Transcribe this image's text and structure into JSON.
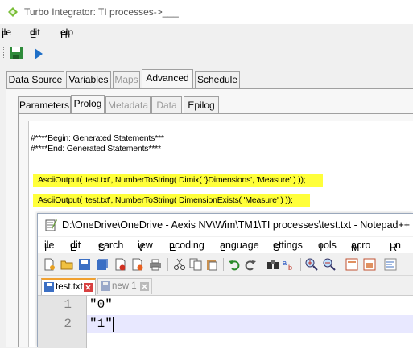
{
  "ti": {
    "title": "Turbo Integrator:  TI processes->___",
    "menu": [
      "File",
      "Edit",
      "Help"
    ],
    "main_tabs": [
      "Data Source",
      "Variables",
      "Maps",
      "Advanced",
      "Schedule"
    ],
    "sub_tabs": [
      "Parameters",
      "Prolog",
      "Metadata",
      "Data",
      "Epilog"
    ],
    "code": [
      "#****Begin: Generated Statements***",
      "#****End: Generated Statements****",
      "AsciiOutput( 'test.txt', NumberToString( Dimix( '}Dimensions', 'Measure' ) ));",
      "AsciiOutput( 'test.txt', NumberToString( DimensionExists( 'Measure' ) ));"
    ]
  },
  "npp": {
    "title": "D:\\OneDrive\\OneDrive - Aexis NV\\Wim\\TM1\\TI processes\\test.txt - Notepad++",
    "menu": [
      "File",
      "Edit",
      "Search",
      "View",
      "Encoding",
      "Language",
      "Settings",
      "Tools",
      "Macro",
      "Run"
    ],
    "tabs": [
      "test.txt",
      "new 1"
    ],
    "lines": [
      {
        "num": "1",
        "text": "\"0\""
      },
      {
        "num": "2",
        "text": "\"1\""
      }
    ]
  },
  "colors": {
    "highlight": "#ffff3a",
    "current_line": "#e8e8ff",
    "save_green": "#2e8b3a",
    "run_blue": "#1e6fc7"
  }
}
